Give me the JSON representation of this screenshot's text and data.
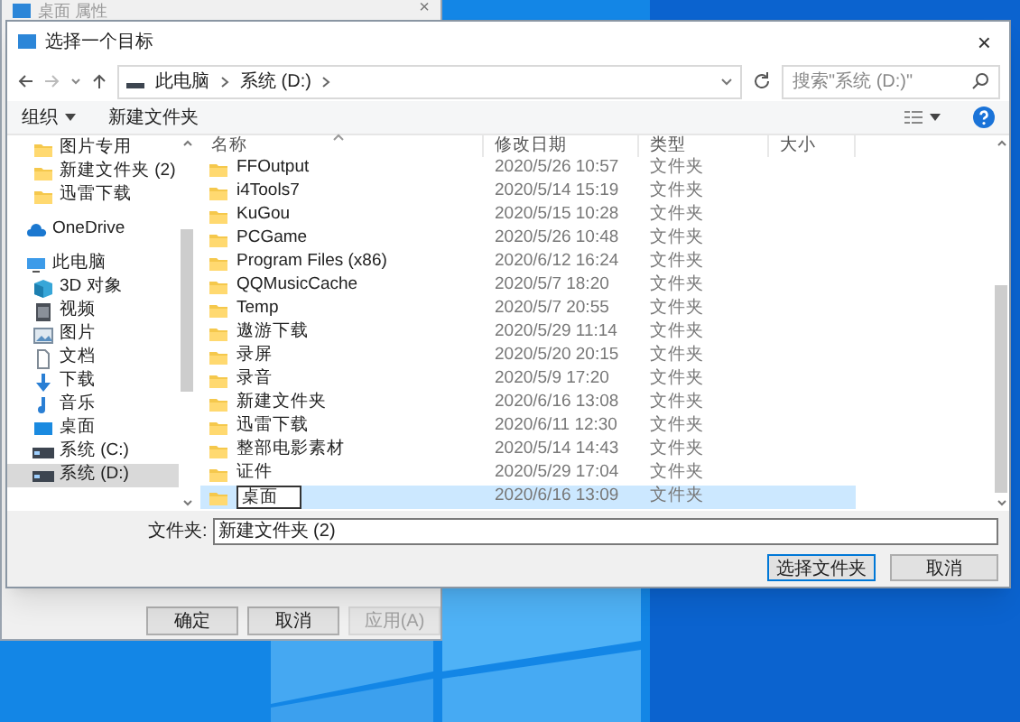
{
  "background_window": {
    "title": "桌面 属性",
    "close_glyph": "×",
    "buttons": [
      {
        "label": "确定",
        "disabled": false
      },
      {
        "label": "取消",
        "disabled": false
      },
      {
        "label": "应用(A)",
        "disabled": true
      }
    ]
  },
  "dialog": {
    "title": "选择一个目标",
    "close_glyph": "×",
    "breadcrumb": [
      "此电脑",
      "系统 (D:)"
    ],
    "search": {
      "placeholder": "搜索\"系统 (D:)\""
    },
    "toolbar": {
      "organize": "组织",
      "new_folder": "新建文件夹"
    },
    "quick_access_items": [
      {
        "label": "图片专用",
        "kind": "folder",
        "selected": false
      },
      {
        "label": "新建文件夹 (2)",
        "kind": "folder",
        "selected": false
      },
      {
        "label": "迅雷下载",
        "kind": "folder",
        "selected": false
      }
    ],
    "nav": [
      {
        "label": "OneDrive",
        "kind": "cloud",
        "selected": false
      },
      {
        "label": "此电脑",
        "kind": "pc",
        "selected": false,
        "children": [
          {
            "label": "3D 对象",
            "kind": "cube",
            "selected": false
          },
          {
            "label": "视频",
            "kind": "video",
            "selected": false
          },
          {
            "label": "图片",
            "kind": "picture",
            "selected": false
          },
          {
            "label": "文档",
            "kind": "document",
            "selected": false
          },
          {
            "label": "下载",
            "kind": "download",
            "selected": false
          },
          {
            "label": "音乐",
            "kind": "music",
            "selected": false
          },
          {
            "label": "桌面",
            "kind": "desktop",
            "selected": false
          },
          {
            "label": "系统 (C:)",
            "kind": "drive",
            "selected": false
          },
          {
            "label": "系统 (D:)",
            "kind": "drive",
            "selected": true
          }
        ]
      }
    ],
    "columns": [
      "名称",
      "修改日期",
      "类型",
      "大小"
    ],
    "rows": [
      {
        "name": "FFOutput",
        "modified": "2020/5/26 10:57",
        "type": "文件夹",
        "selected": false,
        "renaming": false
      },
      {
        "name": "i4Tools7",
        "modified": "2020/5/14 15:19",
        "type": "文件夹",
        "selected": false,
        "renaming": false
      },
      {
        "name": "KuGou",
        "modified": "2020/5/15 10:28",
        "type": "文件夹",
        "selected": false,
        "renaming": false
      },
      {
        "name": "PCGame",
        "modified": "2020/5/26 10:48",
        "type": "文件夹",
        "selected": false,
        "renaming": false
      },
      {
        "name": "Program Files (x86)",
        "modified": "2020/6/12 16:24",
        "type": "文件夹",
        "selected": false,
        "renaming": false
      },
      {
        "name": "QQMusicCache",
        "modified": "2020/5/7 18:20",
        "type": "文件夹",
        "selected": false,
        "renaming": false
      },
      {
        "name": "Temp",
        "modified": "2020/5/7 20:55",
        "type": "文件夹",
        "selected": false,
        "renaming": false
      },
      {
        "name": "遨游下载",
        "modified": "2020/5/29 11:14",
        "type": "文件夹",
        "selected": false,
        "renaming": false
      },
      {
        "name": "录屏",
        "modified": "2020/5/20 20:15",
        "type": "文件夹",
        "selected": false,
        "renaming": false
      },
      {
        "name": "录音",
        "modified": "2020/5/9 17:20",
        "type": "文件夹",
        "selected": false,
        "renaming": false
      },
      {
        "name": "新建文件夹",
        "modified": "2020/6/16 13:08",
        "type": "文件夹",
        "selected": false,
        "renaming": false
      },
      {
        "name": "迅雷下载",
        "modified": "2020/6/11 12:30",
        "type": "文件夹",
        "selected": false,
        "renaming": false
      },
      {
        "name": "整部电影素材",
        "modified": "2020/5/14 14:43",
        "type": "文件夹",
        "selected": false,
        "renaming": false
      },
      {
        "name": "证件",
        "modified": "2020/5/29 17:04",
        "type": "文件夹",
        "selected": false,
        "renaming": false
      },
      {
        "name": "桌面",
        "modified": "2020/6/16 13:09",
        "type": "文件夹",
        "selected": true,
        "renaming": true
      }
    ],
    "folder_field": {
      "label": "文件夹:",
      "value": "新建文件夹 (2)"
    },
    "buttons": [
      {
        "label": "选择文件夹",
        "default": true
      },
      {
        "label": "取消",
        "default": false
      }
    ]
  }
}
